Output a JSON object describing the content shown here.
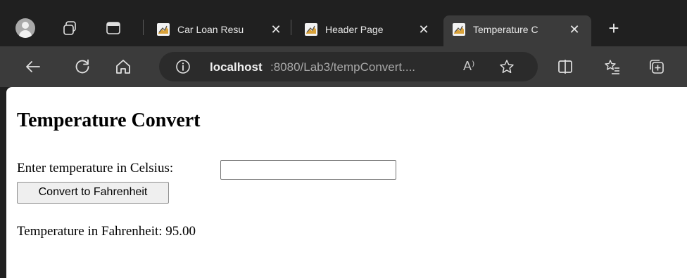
{
  "browser": {
    "tabs": [
      {
        "title": "Car Loan Resu",
        "close": "✕",
        "active": false
      },
      {
        "title": "Header Page",
        "close": "✕",
        "active": false
      },
      {
        "title": "Temperature C",
        "close": "✕",
        "active": true
      }
    ],
    "new_tab": "+",
    "address": {
      "host": "localhost",
      "rest": ":8080/Lab3/tempConvert....",
      "read_aloud": "A⁾"
    },
    "icons": {
      "tabbar": [
        "profile-avatar-icon",
        "workspaces-icon",
        "tab-actions-icon"
      ],
      "toolbar": [
        "back-icon",
        "refresh-icon",
        "home-icon",
        "site-info-icon",
        "read-aloud-icon",
        "favorite-star-icon",
        "split-screen-icon",
        "favorites-list-icon",
        "collections-icon"
      ]
    },
    "colors": {
      "chrome": "#202020",
      "toolbar": "#3b3b3b",
      "page": "#ffffff"
    }
  },
  "page": {
    "heading": "Temperature Convert",
    "input_label": "Enter temperature in Celsius:",
    "input_value": "",
    "button_label": "Convert to Fahrenheit",
    "result_text": "Temperature in Fahrenheit: 95.00"
  }
}
